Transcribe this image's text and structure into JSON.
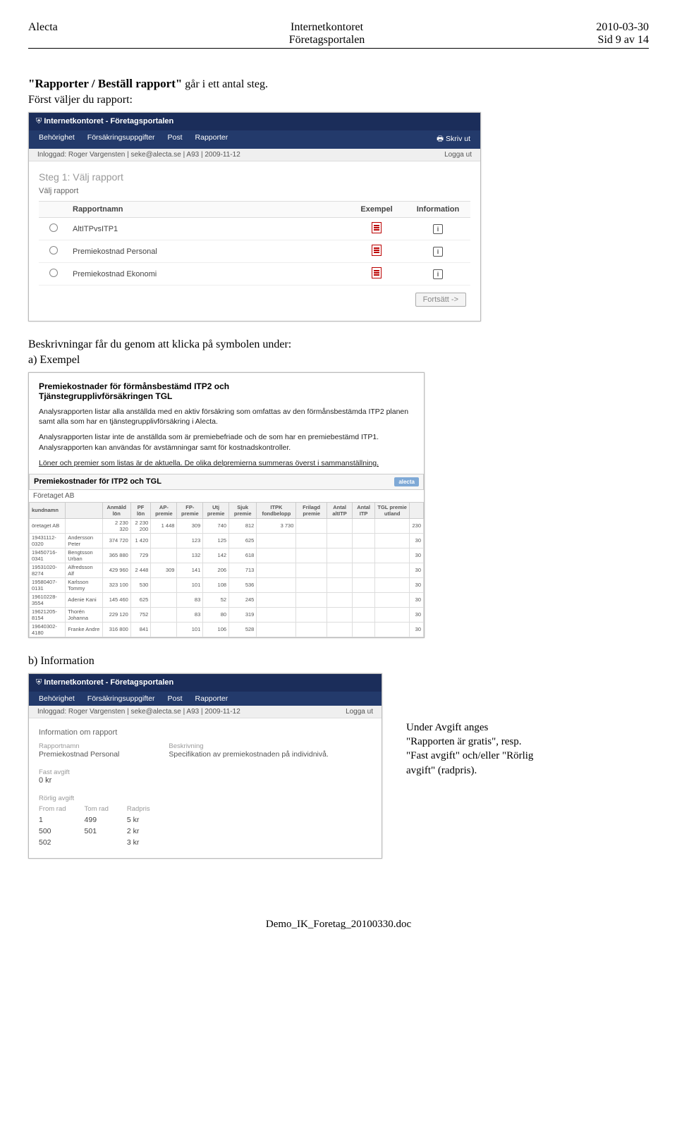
{
  "header": {
    "left": "Alecta",
    "center1": "Internetkontoret",
    "center2": "Företagsportalen",
    "right1": "2010-03-30",
    "right2": "Sid 9 av 14"
  },
  "intro": {
    "title_prefix": "\"Rapporter / Beställ rapport\"",
    "title_rest": " går i ett antal steg.",
    "line2": "Först väljer du rapport:"
  },
  "portal": {
    "title": "Internetkontoret - Företagsportalen",
    "nav": {
      "items": [
        "Behörighet",
        "Försäkringsuppgifter",
        "Post",
        "Rapporter"
      ],
      "print": "Skriv ut"
    },
    "login_left": "Inloggad: Roger Vargensten | seke@alecta.se | A93 | 2009-11-12",
    "login_right": "Logga ut",
    "step_title": "Steg 1: Välj rapport",
    "step_sub": "Välj rapport",
    "cols": {
      "name": "Rapportnamn",
      "exempel": "Exempel",
      "info": "Information"
    },
    "rows": [
      {
        "name": "AltITPvsITP1"
      },
      {
        "name": "Premiekostnad Personal"
      },
      {
        "name": "Premiekostnad Ekonomi"
      }
    ],
    "continue": "Fortsätt ->"
  },
  "between1": "Beskrivningar får du genom att klicka på symbolen under:",
  "a_label": "a) Exempel",
  "b_label": "b) Information",
  "shot_a": {
    "h1": "Premiekostnader för förmånsbestämd ITP2 och",
    "h2": "Tjänstegrupplivförsäkringen TGL",
    "p1": "Analysrapporten listar alla anställda med en aktiv försäkring som omfattas av den förmånsbestämda ITP2 planen samt alla som har en tjänstegrupplivförsäkring i Alecta.",
    "p2": "Analysrapporten listar inte de anställda som är premiebefriade och de som har en premiebestämd ITP1. Analysrapporten kan användas för avstämningar samt för kostnadskontroller.",
    "p3": "Löner och premier som listas är de aktuella. De olika delpremierna summeras överst i sammanställning.",
    "inner_title": "Premiekostnader för ITP2 och TGL",
    "logo": "alecta",
    "company": "Företaget AB",
    "mini_headers": [
      "kundnamn",
      "",
      "Anmäld lön",
      "PF lön",
      "AP-premie",
      "FP-premie",
      "Utj premie",
      "Sjuk premie",
      "ITPK fondbelopp",
      "Frilagd premie",
      "Antal altITP",
      "Antal ITP",
      "TGL premie utland",
      ""
    ],
    "mini_rows": [
      [
        "öretaget AB",
        "",
        "2 230 320",
        "2 230 200",
        "1 448",
        "309",
        "740",
        "812",
        "3 730",
        "",
        "",
        "",
        "",
        "230"
      ],
      [
        "19431112-0320",
        "Andersson Peter",
        "374 720",
        "1 420",
        "",
        "123",
        "125",
        "625",
        "",
        "",
        "",
        "",
        "",
        "30"
      ],
      [
        "19450716-0341",
        "Bengtsson Urban",
        "365 880",
        "729",
        "",
        "132",
        "142",
        "618",
        "",
        "",
        "",
        "",
        "",
        "30"
      ],
      [
        "19531020-8274",
        "Alfredsson Alf",
        "429 960",
        "2 448",
        "309",
        "141",
        "206",
        "713",
        "",
        "",
        "",
        "",
        "",
        "30"
      ],
      [
        "19580407-0131",
        "Karlsson Tommy",
        "323 100",
        "530",
        "",
        "101",
        "108",
        "536",
        "",
        "",
        "",
        "",
        "",
        "30"
      ],
      [
        "19610228-3554",
        "Adenie Kani",
        "145 460",
        "625",
        "",
        "83",
        "52",
        "245",
        "",
        "",
        "",
        "",
        "",
        "30"
      ],
      [
        "19621205-8154",
        "Thorén Johanna",
        "229 120",
        "752",
        "",
        "83",
        "80",
        "319",
        "",
        "",
        "",
        "",
        "",
        "30"
      ],
      [
        "19640302-4180",
        "Franke Andre",
        "316 800",
        "841",
        "",
        "101",
        "106",
        "528",
        "",
        "",
        "",
        "",
        "",
        "30"
      ]
    ]
  },
  "shot_b": {
    "heading": "Information om rapport",
    "col1_label": "Rapportnamn",
    "col1_value": "Premiekostnad Personal",
    "col2_label": "Beskrivning",
    "col2_value": "Specifikation av premiekostnaden på individnivå.",
    "fast_head": "Fast avgift",
    "fast_val": "0 kr",
    "rorlig_head": "Rörlig avgift",
    "tbl_headers": [
      "From rad",
      "Tom rad",
      "Radpris"
    ],
    "tbl_rows": [
      [
        "1",
        "499",
        "5 kr"
      ],
      [
        "500",
        "501",
        "2 kr"
      ],
      [
        "502",
        "",
        "3 kr"
      ]
    ]
  },
  "right_note": {
    "l1": "Under Avgift anges",
    "l2": "\"Rapporten är gratis\", resp.",
    "l3": "\"Fast avgift\" och/eller \"Rörlig",
    "l4": "avgift\" (radpris)."
  },
  "footer": "Demo_IK_Foretag_20100330.doc"
}
